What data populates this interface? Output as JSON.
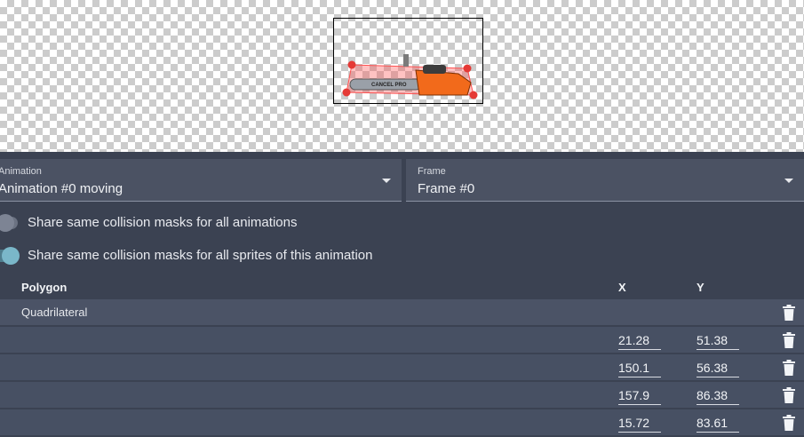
{
  "animation_select": {
    "label": "Animation",
    "value": "Animation #0 moving"
  },
  "frame_select": {
    "label": "Frame",
    "value": "Frame #0"
  },
  "toggles": [
    {
      "label": "Share same collision masks for all animations",
      "on": false
    },
    {
      "label": "Share same collision masks for all sprites of this animation",
      "on": true
    }
  ],
  "table": {
    "headers": {
      "polygon": "Polygon",
      "x": "X",
      "y": "Y"
    },
    "polygon_name": "Quadrilateral",
    "vertices": [
      {
        "x": "21.28",
        "y": "51.38"
      },
      {
        "x": "150.1",
        "y": "56.38"
      },
      {
        "x": "157.9",
        "y": "86.38"
      },
      {
        "x": "15.72",
        "y": "83.61"
      }
    ]
  },
  "sprite": {
    "brand_text": "CANCEL PRO",
    "body_color": "#f26a1b",
    "mask_color": "#ff5050",
    "handle_color": "#e53935"
  },
  "icons": {
    "delete": "trash-icon",
    "dropdown": "chevron-down-icon"
  }
}
